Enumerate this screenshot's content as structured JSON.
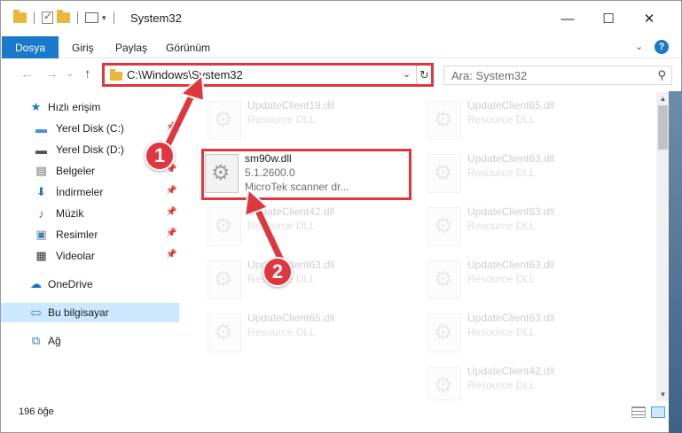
{
  "window": {
    "title": "System32",
    "minimize_glyph": "—",
    "maximize_glyph": "☐",
    "close_glyph": "✕"
  },
  "ribbon": {
    "tabs": [
      "Dosya",
      "Giriş",
      "Paylaş",
      "Görünüm"
    ],
    "active_tab_color": "#1979ca"
  },
  "addressbar": {
    "path": "C:\\Windows\\System32",
    "search_placeholder": "Ara: System32"
  },
  "navpane": {
    "quick_access": "Hızlı erişim",
    "items": [
      {
        "label": "Yerel Disk (C:)",
        "icon": "drive-icon",
        "pinned": true
      },
      {
        "label": "Yerel Disk (D:)",
        "icon": "drive-icon",
        "pinned": false
      },
      {
        "label": "Belgeler",
        "icon": "documents-icon",
        "pinned": true
      },
      {
        "label": "İndirmeler",
        "icon": "downloads-icon",
        "pinned": true
      },
      {
        "label": "Müzik",
        "icon": "music-icon",
        "pinned": true
      },
      {
        "label": "Resimler",
        "icon": "pictures-icon",
        "pinned": true
      },
      {
        "label": "Videolar",
        "icon": "videos-icon",
        "pinned": true
      }
    ],
    "onedrive": "OneDrive",
    "this_pc": "Bu bilgisayar",
    "network": "Ağ"
  },
  "files": {
    "highlighted": {
      "name": "sm90w.dll",
      "version": "5.1.2600.0",
      "description": "MicroTek scanner dr..."
    },
    "faded_left": [
      {
        "name": "UpdateClient19.dll",
        "type": "Resource DLL"
      },
      {
        "name": "UpdateClient42.dll",
        "type": "Resource DLL"
      },
      {
        "name": "UpdateClient63.dll",
        "type": "Resource DLL"
      },
      {
        "name": "UpdateClient65.dll",
        "type": "Resource DLL"
      }
    ],
    "faded_right": [
      {
        "name": "UpdateClient65.dll",
        "type": "Resource DLL"
      },
      {
        "name": "UpdateClient63.dll",
        "type": "Resource DLL"
      },
      {
        "name": "UpdateClient63.dll",
        "type": "Resource DLL"
      },
      {
        "name": "UpdateClient63.dll",
        "type": "Resource DLL"
      },
      {
        "name": "UpdateClient63.dll",
        "type": "Resource DLL"
      },
      {
        "name": "UpdateClient42.dll",
        "type": "Resource DLL"
      }
    ]
  },
  "status": {
    "item_count": "196 öğe"
  },
  "annotations": {
    "step1": "1",
    "step2": "2",
    "color": "#e0363f"
  }
}
